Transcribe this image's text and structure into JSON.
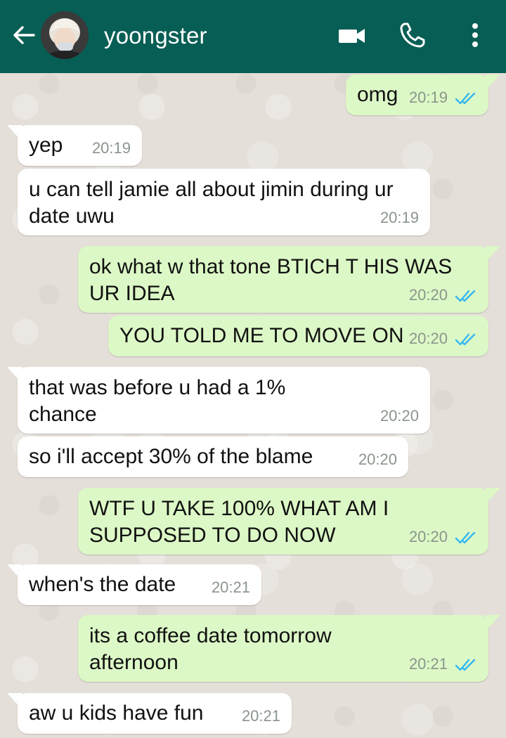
{
  "header": {
    "contact_name": "yoongster",
    "back_icon": "arrow-left-icon",
    "video_icon": "video-call-icon",
    "call_icon": "phone-icon",
    "menu_icon": "more-vertical-icon",
    "bg_color": "#075e54"
  },
  "messages": [
    {
      "dir": "out",
      "text": "omg",
      "time": "20:19",
      "status": "read"
    },
    {
      "dir": "in",
      "text": "yep",
      "time": "20:19"
    },
    {
      "dir": "in",
      "text": "u can tell jamie all about jimin during ur\ndate uwu",
      "time": "20:19"
    },
    {
      "dir": "out",
      "text": "ok what w that tone BTICH T HIS WAS\nUR IDEA",
      "time": "20:20",
      "status": "read"
    },
    {
      "dir": "out",
      "text": "YOU TOLD ME TO MOVE ON",
      "time": "20:20",
      "status": "read"
    },
    {
      "dir": "in",
      "text": "that was before u had a 1%\nchance",
      "time": "20:20"
    },
    {
      "dir": "in",
      "text": "so i'll accept 30% of the blame",
      "time": "20:20"
    },
    {
      "dir": "out",
      "text": "WTF U TAKE 100% WHAT AM I\nSUPPOSED TO DO NOW",
      "time": "20:20",
      "status": "read"
    },
    {
      "dir": "in",
      "text": "when's the date",
      "time": "20:21"
    },
    {
      "dir": "out",
      "text": "its a coffee date tomorrow\nafternoon",
      "time": "20:21",
      "status": "read"
    },
    {
      "dir": "in",
      "text": "aw u kids have fun",
      "time": "20:21"
    }
  ],
  "colors": {
    "incoming_bubble": "#ffffff",
    "outgoing_bubble": "#dcf8c6",
    "read_tick": "#34b7f1"
  }
}
